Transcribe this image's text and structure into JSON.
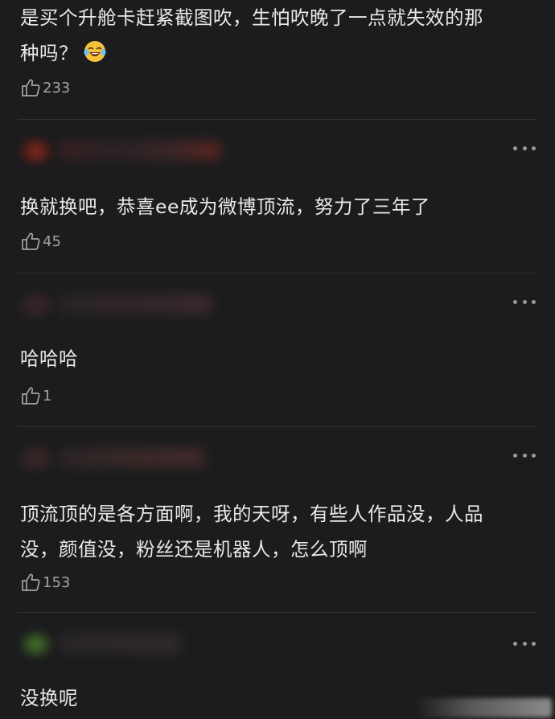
{
  "colors": {
    "background": "#1c1c1e",
    "text": "#e9e9ea",
    "meta": "#a3a3a6",
    "divider": "#303033"
  },
  "comments": [
    {
      "text_line1": "是买个升舱卡赶紧截图吹，生怕吹晚了一点就失效的那",
      "text_line2": "种吗？",
      "emoji": "laughing-tears-emoji",
      "likes": "233"
    },
    {
      "text": "换就换吧，恭喜ee成为微博顶流，努力了三年了",
      "likes": "45"
    },
    {
      "text": "哈哈哈",
      "likes": "1"
    },
    {
      "text_line1": "顶流顶的是各方面啊，我的天呀，有些人作品没，人品",
      "text_line2": "没，颜值没，粉丝还是机器人，怎么顶啊",
      "likes": "153"
    },
    {
      "text": "没换呢"
    }
  ],
  "icons": {
    "like": "thumbs-up-icon",
    "more": "more-dots-icon"
  }
}
